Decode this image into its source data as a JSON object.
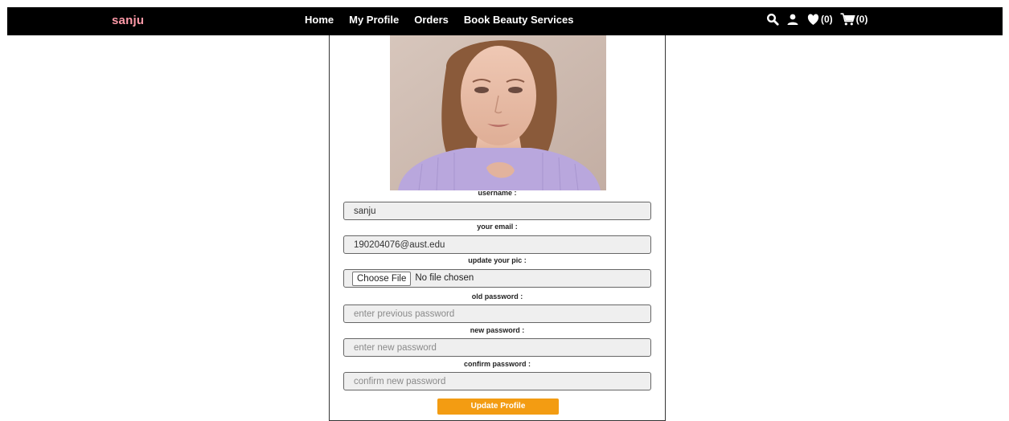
{
  "navbar": {
    "brand": "sanju",
    "links": [
      {
        "label": "Home"
      },
      {
        "label": "My Profile"
      },
      {
        "label": "Orders"
      },
      {
        "label": "Book Beauty Services"
      }
    ],
    "icons": [
      "search-icon",
      "user-icon",
      "heart-icon",
      "cart-icon"
    ],
    "wishlist_count": "(0)",
    "cart_count": "(0)"
  },
  "profile": {
    "photo": "profile-photo",
    "username_label": "username :",
    "username_value": "sanju",
    "email_label": "your email :",
    "email_value": "190204076@aust.edu",
    "pic_label": "update your pic :",
    "file_button": "Choose File",
    "file_status": "No file chosen",
    "old_password_label": "old password :",
    "old_password_placeholder": "enter previous password",
    "new_password_label": "new password :",
    "new_password_placeholder": "enter new password",
    "confirm_password_label": "confirm password :",
    "confirm_password_placeholder": "confirm new password",
    "submit_label": "Update Profile"
  },
  "colors": {
    "navbar_bg": "#000000",
    "brand": "#ff9aa8",
    "button": "#f39c12"
  }
}
